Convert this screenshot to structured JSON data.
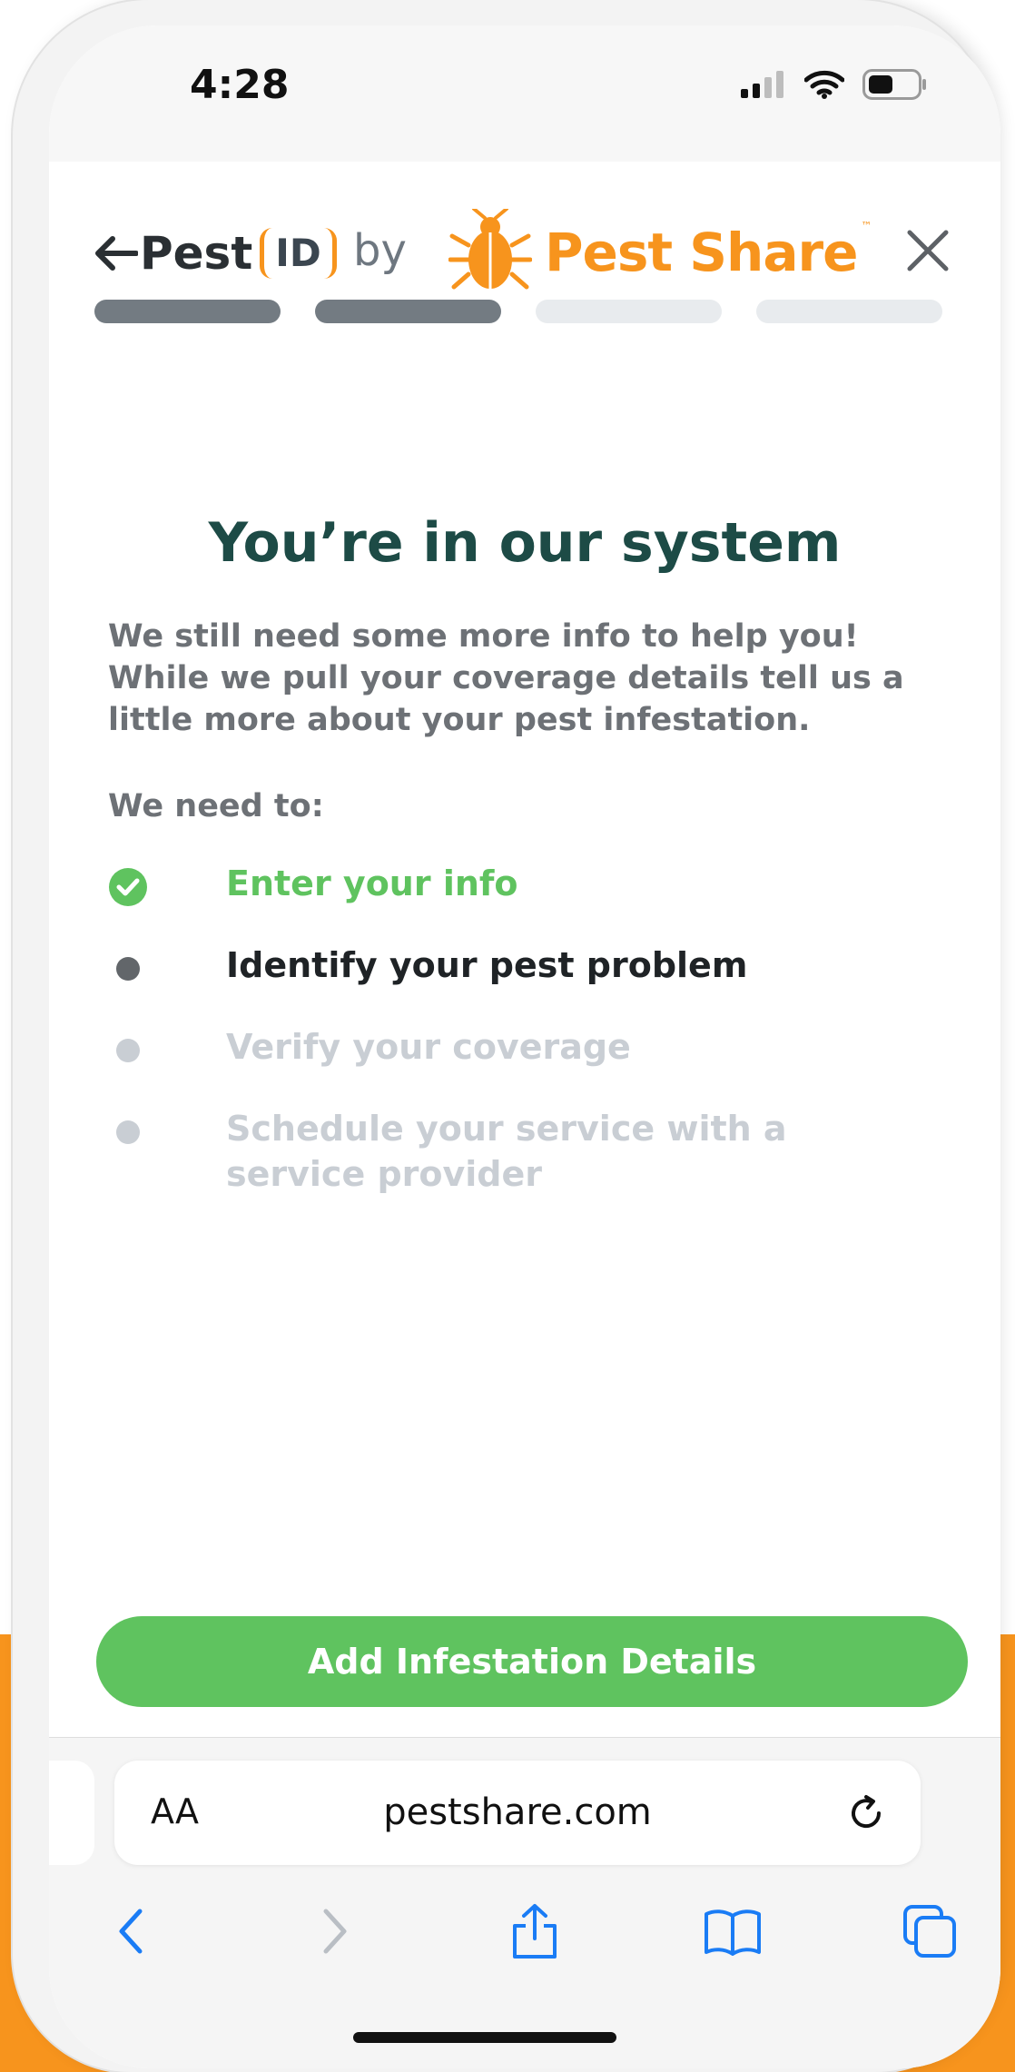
{
  "status_bar": {
    "time": "4:28"
  },
  "header": {
    "back_label": "Back",
    "logo_pest": "Pest",
    "logo_id": "ID",
    "by": "by",
    "brand_name": "Pest Share",
    "brand_tm": "™"
  },
  "progress": {
    "total_steps": 4,
    "completed_steps": 2
  },
  "main": {
    "title": "You’re in our system",
    "lead": "We still need some more info to help you! While we pull your coverage details tell us a little more about your pest infestation.",
    "need_label": "We need to:",
    "steps": [
      {
        "label": "Enter your info",
        "state": "done"
      },
      {
        "label": "Identify your pest problem",
        "state": "current"
      },
      {
        "label": "Verify your coverage",
        "state": "pending"
      },
      {
        "label": "Schedule your service with a service provider",
        "state": "pending"
      }
    ],
    "cta_label": "Add Infestation Details"
  },
  "safari": {
    "aa": "AA",
    "url": "pestshare.com"
  },
  "colors": {
    "orange": "#f7941d",
    "green": "#5fc35f",
    "title": "#1d4b46",
    "progress_done": "#737b82",
    "progress_pending": "#e8ebee",
    "step_pending": "#c9ced4",
    "link_blue": "#1a7cf5"
  },
  "icons": [
    "back-arrow-icon",
    "close-icon",
    "beetle-logo-icon",
    "check-circle-icon",
    "reload-icon",
    "chevron-left-icon",
    "chevron-right-icon",
    "share-icon",
    "bookmarks-icon",
    "tabs-icon",
    "signal-icon",
    "wifi-icon",
    "battery-icon"
  ]
}
